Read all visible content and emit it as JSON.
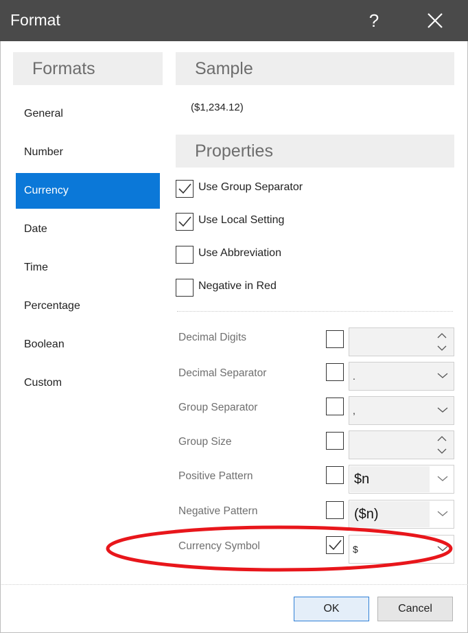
{
  "dialog": {
    "title": "Format",
    "help_glyph": "?",
    "close_icon": "close-icon"
  },
  "formats": {
    "header": "Formats",
    "items": [
      {
        "label": "General",
        "active": false
      },
      {
        "label": "Number",
        "active": false
      },
      {
        "label": "Currency",
        "active": true
      },
      {
        "label": "Date",
        "active": false
      },
      {
        "label": "Time",
        "active": false
      },
      {
        "label": "Percentage",
        "active": false
      },
      {
        "label": "Boolean",
        "active": false
      },
      {
        "label": "Custom",
        "active": false
      }
    ]
  },
  "sample": {
    "header": "Sample",
    "value": "($1,234.12)"
  },
  "properties": {
    "header": "Properties",
    "checks": [
      {
        "label": "Use Group Separator",
        "checked": true
      },
      {
        "label": "Use Local Setting",
        "checked": true
      },
      {
        "label": "Use Abbreviation",
        "checked": false
      },
      {
        "label": "Negative in Red",
        "checked": false
      }
    ],
    "rows": [
      {
        "label": "Decimal Digits",
        "checked": false,
        "control": "spinner",
        "value": ""
      },
      {
        "label": "Decimal Separator",
        "checked": false,
        "control": "dropdown",
        "value": "."
      },
      {
        "label": "Group Separator",
        "checked": false,
        "control": "dropdown",
        "value": ","
      },
      {
        "label": "Group Size",
        "checked": false,
        "control": "spinner",
        "value": ""
      },
      {
        "label": "Positive Pattern",
        "checked": false,
        "control": "pattern-dropdown",
        "value": "$n"
      },
      {
        "label": "Negative Pattern",
        "checked": false,
        "control": "pattern-dropdown",
        "value": "($n)"
      },
      {
        "label": "Currency Symbol",
        "checked": true,
        "control": "dropdown",
        "value": "$"
      }
    ]
  },
  "buttons": {
    "ok": "OK",
    "cancel": "Cancel"
  },
  "colors": {
    "titlebar": "#4a4a4a",
    "selected_item": "#0b78d8",
    "annotation_ellipse": "#e8161b"
  }
}
